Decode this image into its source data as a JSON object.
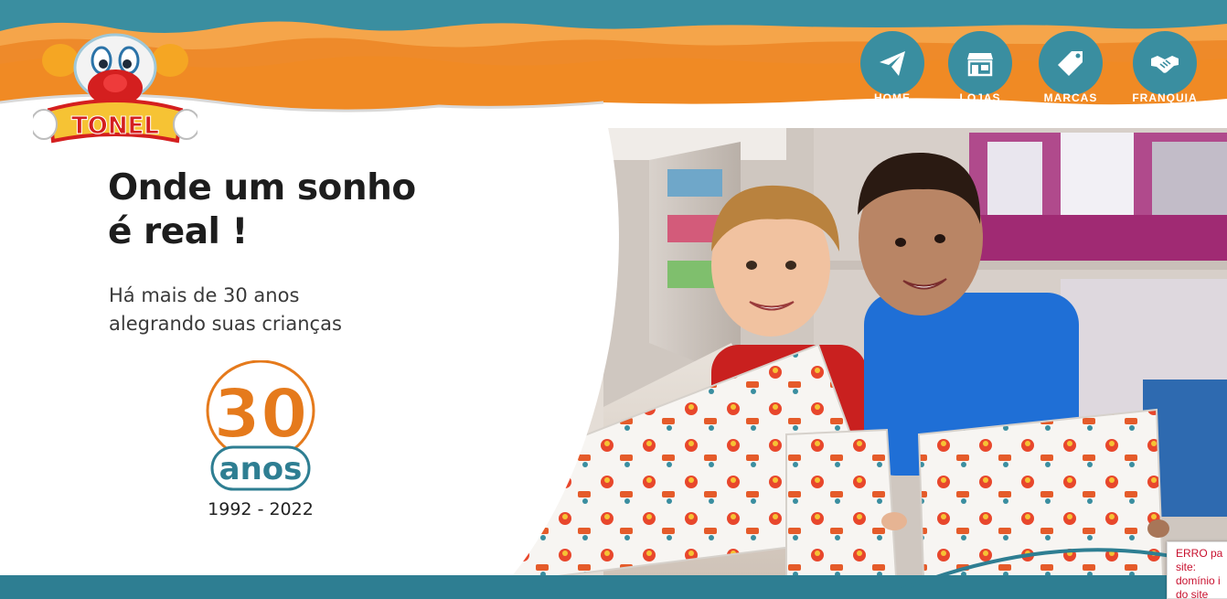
{
  "brand": {
    "name": "TONEL",
    "logo_icon": "clown-mascot-icon"
  },
  "nav": {
    "items": [
      {
        "label": "HOME",
        "icon": "paper-plane-icon"
      },
      {
        "label": "LOJAS",
        "icon": "storefront-icon"
      },
      {
        "label": "MARCAS",
        "icon": "tag-icon"
      },
      {
        "label": "FRANQUIA",
        "icon": "handshake-icon"
      }
    ]
  },
  "hero": {
    "headline_line1": "Onde um sonho",
    "headline_line2": "é real !",
    "subtitle_line1": "Há mais de 30 anos",
    "subtitle_line2": "alegrando suas crianças",
    "anniversary_number": "30",
    "anniversary_word": "anos",
    "anniversary_years": "1992 - 2022",
    "photo_subject": "two-kids-holding-gift-boxes-in-toy-store"
  },
  "error_widget": {
    "line1": "ERRO pa",
    "line2": "site:",
    "line3": "domínio i",
    "line4": "do site"
  },
  "colors": {
    "orange": "#f08a24",
    "teal": "#3a8ea0",
    "dark_teal": "#2e7e92",
    "text_dark": "#1d1d1d",
    "error_red": "#c8102e"
  }
}
